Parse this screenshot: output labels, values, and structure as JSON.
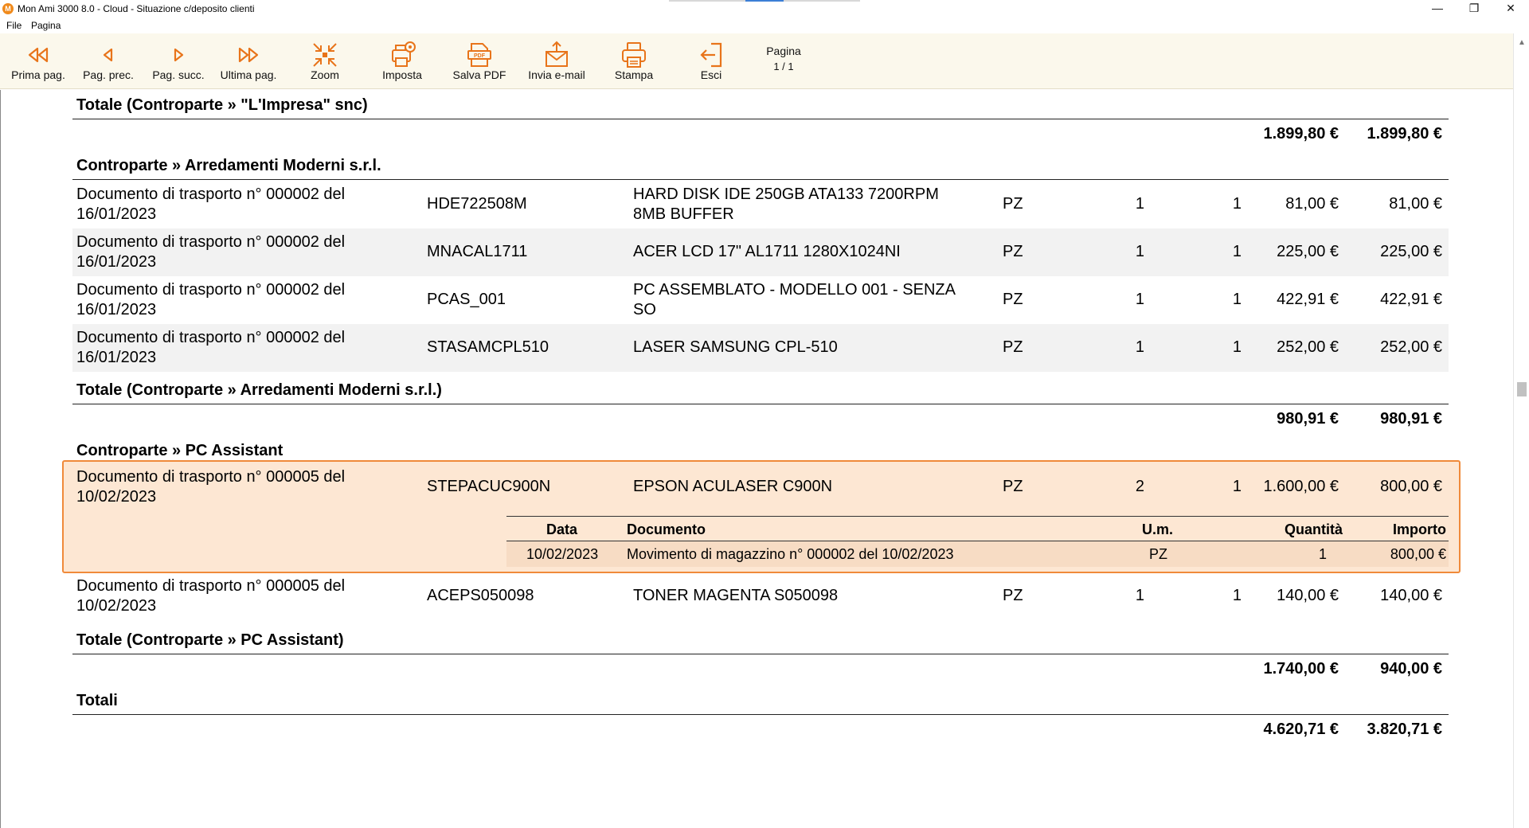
{
  "window": {
    "title": "Mon Ami 3000 8.0 - Cloud - Situazione c/deposito clienti",
    "app_icon": "mon-ami-icon",
    "minimize": "—",
    "restore": "❐",
    "close": "✕"
  },
  "menu": [
    "File",
    "Pagina"
  ],
  "toolbar": {
    "items": [
      {
        "label": "Prima pag.",
        "icon": "first-page-icon"
      },
      {
        "label": "Pag. prec.",
        "icon": "prev-page-icon"
      },
      {
        "label": "Pag. succ.",
        "icon": "next-page-icon"
      },
      {
        "label": "Ultima pag.",
        "icon": "last-page-icon"
      },
      {
        "label": "Zoom",
        "icon": "zoom-icon"
      },
      {
        "label": "Imposta",
        "icon": "printer-settings-icon"
      },
      {
        "label": "Salva PDF",
        "icon": "pdf-icon"
      },
      {
        "label": "Invia e-mail",
        "icon": "email-icon"
      },
      {
        "label": "Stampa",
        "icon": "printer-icon"
      },
      {
        "label": "Esci",
        "icon": "exit-icon"
      }
    ],
    "page_label": "Pagina",
    "page_number": "1 / 1",
    "accent_color": "#f08a1c"
  },
  "report": {
    "prev_total": {
      "label": "Totale (Controparte » \"L'Impresa\" snc)",
      "amount1": "1.899,80 €",
      "amount2": "1.899,80 €"
    },
    "groups": [
      {
        "title": "Controparte » Arredamenti Moderni s.r.l.",
        "rows": [
          {
            "doc": "Documento di trasporto n° 000002 del 16/01/2023",
            "code": "HDE722508M",
            "desc": "HARD DISK IDE 250GB ATA133 7200RPM 8MB BUFFER",
            "um": "PZ",
            "q1": "1",
            "q2": "1",
            "p1": "81,00 €",
            "p2": "81,00 €"
          },
          {
            "doc": "Documento di trasporto n° 000002 del 16/01/2023",
            "code": "MNACAL1711",
            "desc": "ACER LCD 17\" AL1711 1280X1024NI",
            "um": "PZ",
            "q1": "1",
            "q2": "1",
            "p1": "225,00 €",
            "p2": "225,00 €"
          },
          {
            "doc": "Documento di trasporto n° 000002 del 16/01/2023",
            "code": "PCAS_001",
            "desc": "PC ASSEMBLATO - MODELLO 001 - SENZA SO",
            "um": "PZ",
            "q1": "1",
            "q2": "1",
            "p1": "422,91 €",
            "p2": "422,91 €"
          },
          {
            "doc": "Documento di trasporto n° 000002 del 16/01/2023",
            "code": "STASAMCPL510",
            "desc": "LASER SAMSUNG CPL-510",
            "um": "PZ",
            "q1": "1",
            "q2": "1",
            "p1": "252,00 €",
            "p2": "252,00 €"
          }
        ],
        "total": {
          "label": "Totale (Controparte » Arredamenti Moderni s.r.l.)",
          "amount1": "980,91 €",
          "amount2": "980,91 €"
        }
      },
      {
        "title": "Controparte » PC Assistant",
        "rows": [
          {
            "doc": "Documento di trasporto n° 000005 del 10/02/2023",
            "code": "STEPACUC900N",
            "desc": "EPSON ACULASER C900N",
            "um": "PZ",
            "q1": "2",
            "q2": "1",
            "p1": "1.600,00 €",
            "p2": "800,00 €"
          },
          {
            "doc": "Documento di trasporto n° 000005 del 10/02/2023",
            "code": "ACEPS050098",
            "desc": "TONER MAGENTA S050098",
            "um": "PZ",
            "q1": "1",
            "q2": "1",
            "p1": "140,00 €",
            "p2": "140,00 €"
          }
        ],
        "detail": {
          "headers": {
            "data": "Data",
            "documento": "Documento",
            "um": "U.m.",
            "quantita": "Quantità",
            "importo": "Importo"
          },
          "row": {
            "data": "10/02/2023",
            "documento": "Movimento di magazzino n° 000002 del 10/02/2023",
            "um": "PZ",
            "quantita": "1",
            "importo": "800,00 €"
          }
        },
        "total": {
          "label": "Totale (Controparte » PC Assistant)",
          "amount1": "1.740,00 €",
          "amount2": "940,00 €"
        }
      }
    ],
    "grand_total": {
      "label": "Totali",
      "amount1": "4.620,71 €",
      "amount2": "3.820,71 €"
    },
    "selection_color": "#fde7d3"
  }
}
